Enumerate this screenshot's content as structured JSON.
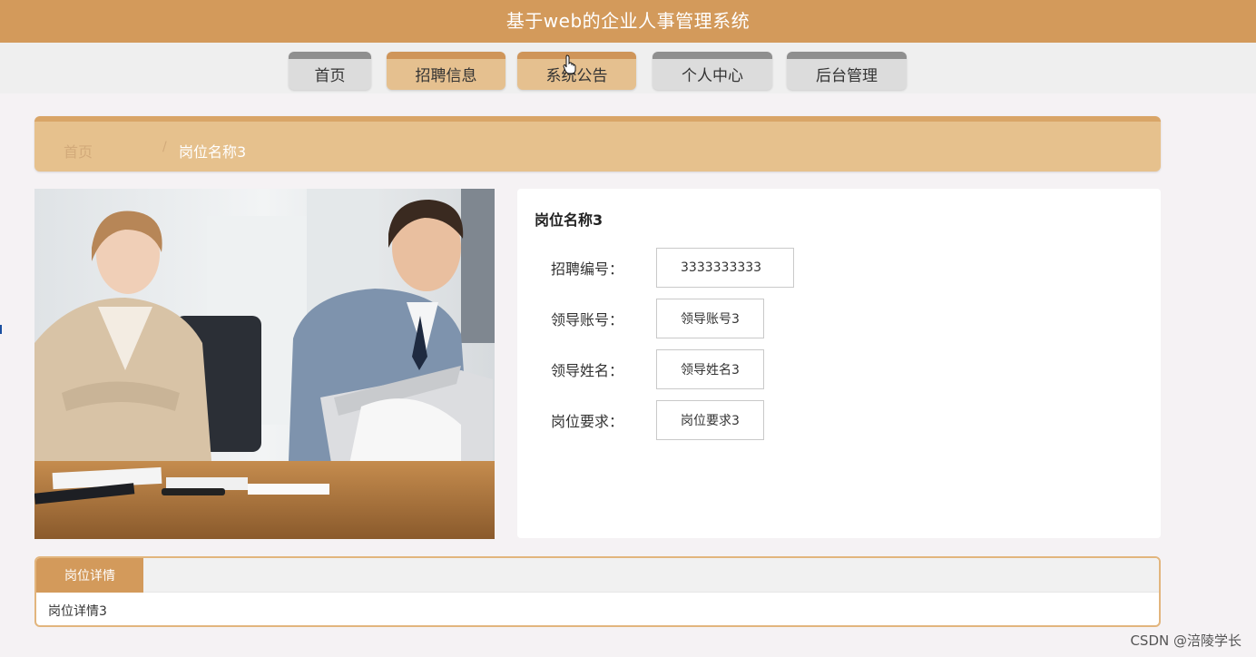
{
  "header": {
    "title": "基于web的企业人事管理系统"
  },
  "nav": [
    {
      "label": "首页",
      "active": false
    },
    {
      "label": "招聘信息",
      "active": true
    },
    {
      "label": "系统公告",
      "active": true
    },
    {
      "label": "个人中心",
      "active": false
    },
    {
      "label": "后台管理",
      "active": false
    }
  ],
  "breadcrumb": {
    "home": "首页",
    "separator": "/",
    "current": "岗位名称3"
  },
  "job": {
    "title": "岗位名称3",
    "fields": [
      {
        "label": "招聘编号：",
        "value": "3333333333"
      },
      {
        "label": "领导账号：",
        "value": "领导账号3"
      },
      {
        "label": "领导姓名：",
        "value": "领导姓名3"
      },
      {
        "label": "岗位要求：",
        "value": "岗位要求3"
      }
    ]
  },
  "details": {
    "tab": "岗位详情",
    "content": "岗位详情3"
  },
  "watermark": "CSDN @涪陵学长",
  "colors": {
    "brand": "#d39a5b",
    "nav_active": "#e5c08f",
    "nav_inactive": "#dcdcdc",
    "breadcrumb_bg": "#e6c18d",
    "page_bg": "#f5f2f4"
  },
  "icons": {
    "cursor": "hand-pointer-icon"
  }
}
